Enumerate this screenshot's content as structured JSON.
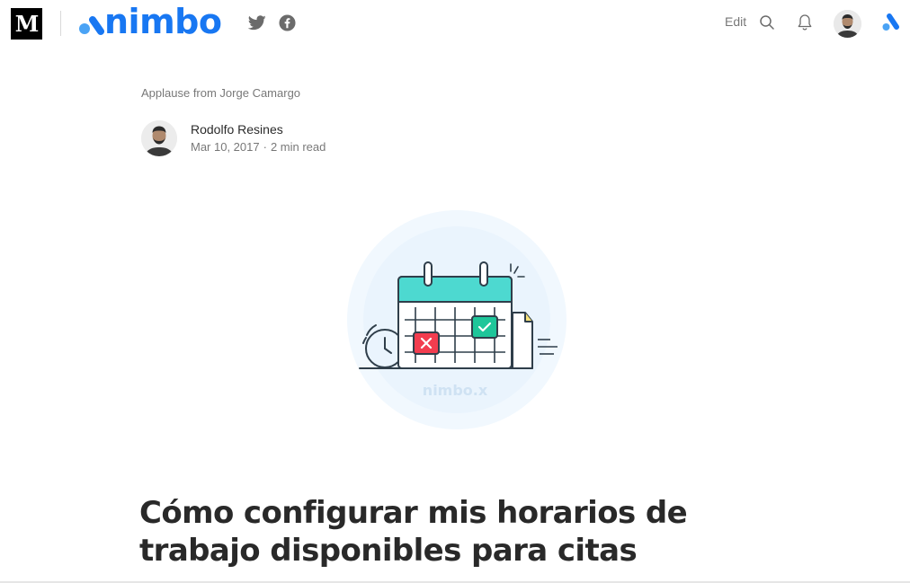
{
  "header": {
    "site_logo": "M",
    "brand_name": "nimbo",
    "social_icons": [
      "twitter-icon",
      "facebook-icon"
    ],
    "edit_label": "Edit",
    "icons": [
      "search-icon",
      "bell-icon",
      "avatar",
      "nimbo-icon"
    ],
    "brand_color": "#1877f2"
  },
  "post": {
    "applause_text": "Applause from Jorge Camargo",
    "author_name": "Rodolfo Resines",
    "date": "Mar 10, 2017",
    "read_time": "2 min read",
    "illustration_watermark": "nimbo.x",
    "title": "Cómo configurar mis horarios de trabajo disponibles para citas"
  },
  "colors": {
    "accent_teal": "#4dd9d0",
    "calendar_x_red": "#f23d4f",
    "calendar_check_green": "#1ec69a",
    "illustration_bg": "#eaf4fd"
  }
}
